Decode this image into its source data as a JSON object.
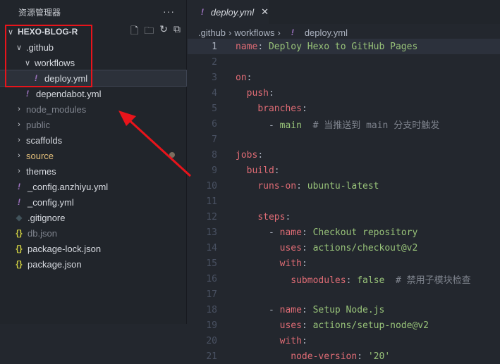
{
  "sidebar": {
    "title": "资源管理器",
    "more": "···",
    "root": "HEXO-BLOG-R",
    "tree": [
      {
        "label": ".github",
        "type": "folder-open",
        "depth": 1,
        "cls": ""
      },
      {
        "label": "workflows",
        "type": "folder-open",
        "depth": 2,
        "cls": ""
      },
      {
        "label": "deploy.yml",
        "type": "yml",
        "depth": 3,
        "cls": "",
        "selected": true
      },
      {
        "label": "dependabot.yml",
        "type": "yml",
        "depth": 2,
        "cls": ""
      },
      {
        "label": "node_modules",
        "type": "folder",
        "depth": 1,
        "cls": "dim"
      },
      {
        "label": "public",
        "type": "folder",
        "depth": 1,
        "cls": "dim"
      },
      {
        "label": "scaffolds",
        "type": "folder",
        "depth": 1,
        "cls": ""
      },
      {
        "label": "source",
        "type": "folder",
        "depth": 1,
        "cls": "mod"
      },
      {
        "label": "themes",
        "type": "folder",
        "depth": 1,
        "cls": ""
      },
      {
        "label": "_config.anzhiyu.yml",
        "type": "yml",
        "depth": 1,
        "cls": ""
      },
      {
        "label": "_config.yml",
        "type": "yml",
        "depth": 1,
        "cls": ""
      },
      {
        "label": ".gitignore",
        "type": "git",
        "depth": 1,
        "cls": ""
      },
      {
        "label": "db.json",
        "type": "json",
        "depth": 1,
        "cls": "dim"
      },
      {
        "label": "package-lock.json",
        "type": "json",
        "depth": 1,
        "cls": ""
      },
      {
        "label": "package.json",
        "type": "json",
        "depth": 1,
        "cls": ""
      }
    ]
  },
  "tab": {
    "label": "deploy.yml",
    "close": "✕"
  },
  "breadcrumb": [
    ".github",
    "workflows",
    "deploy.yml"
  ],
  "code": [
    [
      [
        "key",
        "name"
      ],
      [
        "pun",
        ": "
      ],
      [
        "str",
        "Deploy Hexo to GitHub Pages"
      ]
    ],
    [],
    [
      [
        "key",
        "on"
      ],
      [
        "pun",
        ":"
      ]
    ],
    [
      [
        "plain",
        "  "
      ],
      [
        "key",
        "push"
      ],
      [
        "pun",
        ":"
      ]
    ],
    [
      [
        "plain",
        "    "
      ],
      [
        "key",
        "branches"
      ],
      [
        "pun",
        ":"
      ]
    ],
    [
      [
        "plain",
        "      - "
      ],
      [
        "str",
        "main"
      ],
      [
        "com",
        "  # 当推送到 main 分支时触发"
      ]
    ],
    [],
    [
      [
        "key",
        "jobs"
      ],
      [
        "pun",
        ":"
      ]
    ],
    [
      [
        "plain",
        "  "
      ],
      [
        "key",
        "build"
      ],
      [
        "pun",
        ":"
      ]
    ],
    [
      [
        "plain",
        "    "
      ],
      [
        "key",
        "runs-on"
      ],
      [
        "pun",
        ": "
      ],
      [
        "str",
        "ubuntu-latest"
      ]
    ],
    [],
    [
      [
        "plain",
        "    "
      ],
      [
        "key",
        "steps"
      ],
      [
        "pun",
        ":"
      ]
    ],
    [
      [
        "plain",
        "      - "
      ],
      [
        "key",
        "name"
      ],
      [
        "pun",
        ": "
      ],
      [
        "str",
        "Checkout repository"
      ]
    ],
    [
      [
        "plain",
        "        "
      ],
      [
        "key",
        "uses"
      ],
      [
        "pun",
        ": "
      ],
      [
        "str",
        "actions/checkout@v2"
      ]
    ],
    [
      [
        "plain",
        "        "
      ],
      [
        "key",
        "with"
      ],
      [
        "pun",
        ":"
      ]
    ],
    [
      [
        "plain",
        "          "
      ],
      [
        "key",
        "submodules"
      ],
      [
        "pun",
        ": "
      ],
      [
        "str",
        "false"
      ],
      [
        "com",
        "  # 禁用子模块检查"
      ]
    ],
    [],
    [
      [
        "plain",
        "      - "
      ],
      [
        "key",
        "name"
      ],
      [
        "pun",
        ": "
      ],
      [
        "str",
        "Setup Node.js"
      ]
    ],
    [
      [
        "plain",
        "        "
      ],
      [
        "key",
        "uses"
      ],
      [
        "pun",
        ": "
      ],
      [
        "str",
        "actions/setup-node@v2"
      ]
    ],
    [
      [
        "plain",
        "        "
      ],
      [
        "key",
        "with"
      ],
      [
        "pun",
        ":"
      ]
    ],
    [
      [
        "plain",
        "          "
      ],
      [
        "key",
        "node-version"
      ],
      [
        "pun",
        ": "
      ],
      [
        "str",
        "'20'"
      ]
    ]
  ]
}
